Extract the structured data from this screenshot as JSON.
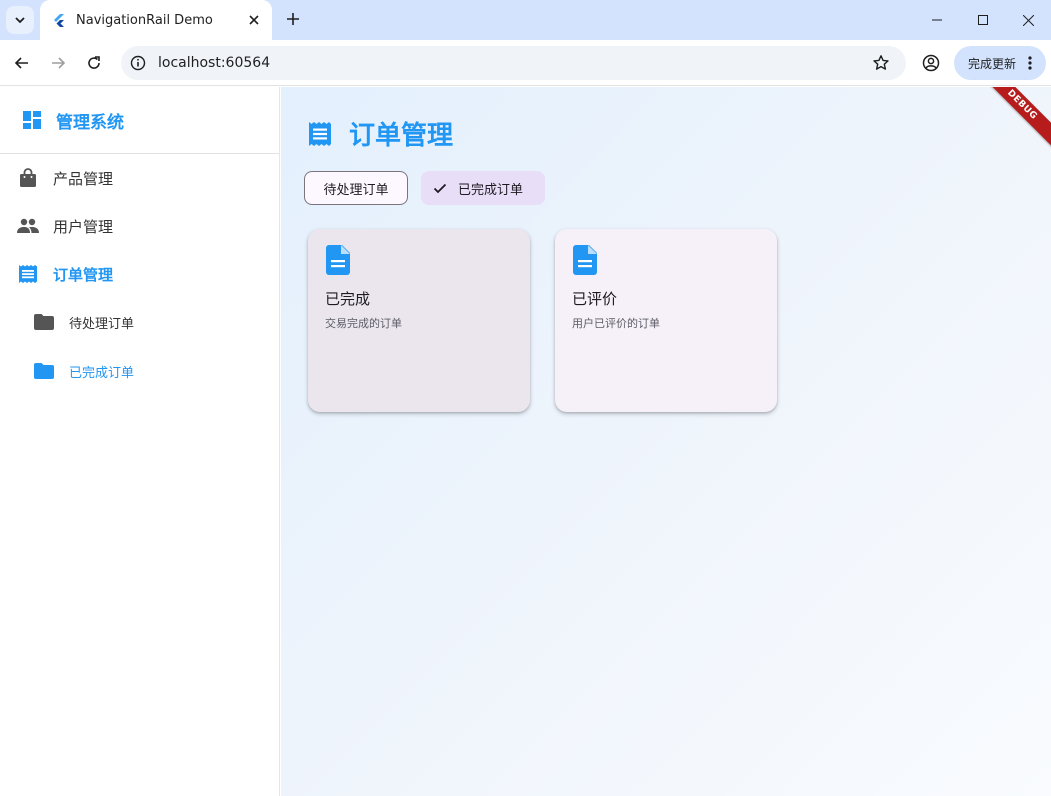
{
  "browser": {
    "tab_title": "NavigationRail Demo",
    "url": "localhost:60564",
    "update_label": "完成更新",
    "icons": {
      "tab_search": "chevron-down-icon",
      "favicon": "flutter-icon",
      "close": "close-icon",
      "new_tab": "plus-icon",
      "back": "arrow-left-icon",
      "forward": "arrow-right-icon",
      "reload": "reload-icon",
      "site_info": "info-icon",
      "bookmark": "star-icon",
      "profile": "account-icon",
      "more": "more-vert-icon"
    }
  },
  "sidebar": {
    "title": "管理系统",
    "items": [
      {
        "label": "产品管理",
        "icon": "shopping-bag-icon"
      },
      {
        "label": "用户管理",
        "icon": "people-icon"
      },
      {
        "label": "订单管理",
        "icon": "receipt-icon",
        "active": true
      }
    ],
    "sub_items": [
      {
        "label": "待处理订单",
        "icon": "folder-icon"
      },
      {
        "label": "已完成订单",
        "icon": "folder-icon",
        "active": true
      }
    ]
  },
  "main": {
    "title": "订单管理",
    "chips": [
      {
        "label": "待处理订单",
        "selected": false
      },
      {
        "label": "已完成订单",
        "selected": true
      }
    ],
    "cards": [
      {
        "title": "已完成",
        "subtitle": "交易完成的订单",
        "icon": "document-icon",
        "bg": "#ebe6ee"
      },
      {
        "title": "已评价",
        "subtitle": "用户已评价的订单",
        "icon": "document-icon",
        "bg": "#f6f1f8"
      }
    ],
    "debug_label": "DEBUG"
  },
  "colors": {
    "accent": "#2196f3",
    "tab_bar": "#d3e3fd",
    "chip_selected": "#e8def8",
    "debug_ribbon": "#b71c1c"
  }
}
